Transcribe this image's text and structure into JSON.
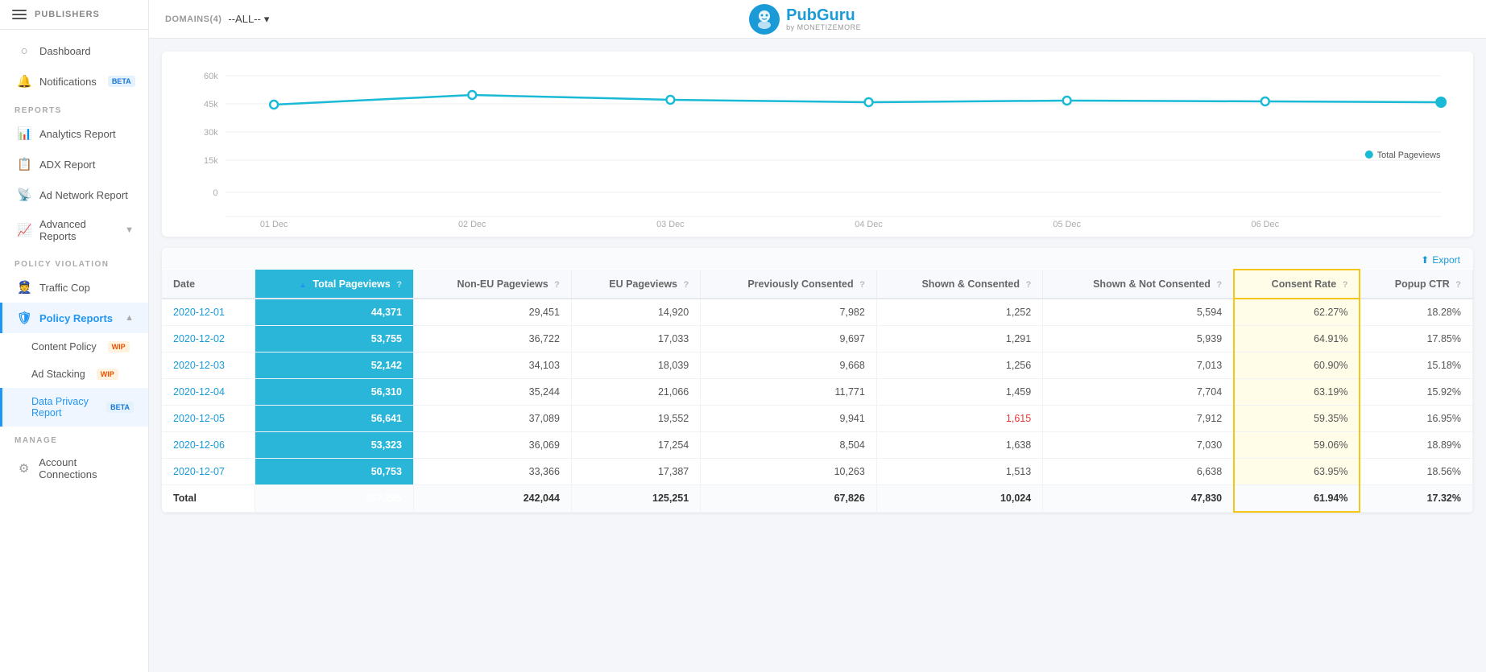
{
  "sidebar": {
    "publishers_label": "PUBLISHERS",
    "nav_items": [
      {
        "id": "dashboard",
        "label": "Dashboard",
        "icon": "○"
      },
      {
        "id": "notifications",
        "label": "Notifications",
        "badge": "BETA",
        "badge_type": "beta",
        "icon": "🔔"
      },
      {
        "id": "analytics_report",
        "label": "Analytics Report",
        "icon": "📊",
        "section": "REPORTS"
      },
      {
        "id": "adx_report",
        "label": "ADX Report",
        "icon": "📋"
      },
      {
        "id": "ad_network_report",
        "label": "Ad Network Report",
        "icon": "📡"
      },
      {
        "id": "advanced_reports",
        "label": "Advanced Reports",
        "icon": "📈",
        "has_chevron": true
      },
      {
        "id": "traffic_cop",
        "label": "Traffic Cop",
        "icon": "👮",
        "section": "POLICY VIOLATION"
      },
      {
        "id": "policy_reports",
        "label": "Policy Reports",
        "icon": "🛡",
        "has_chevron": true,
        "active": true
      },
      {
        "id": "content_policy",
        "label": "Content Policy",
        "badge": "WIP",
        "badge_type": "wip",
        "sub": true
      },
      {
        "id": "ad_stacking",
        "label": "Ad Stacking",
        "badge": "WIP",
        "badge_type": "wip",
        "sub": true
      },
      {
        "id": "data_privacy",
        "label": "Data Privacy Report",
        "badge": "BETA",
        "badge_type": "beta",
        "sub": true,
        "active_sub": true
      },
      {
        "id": "account_connections",
        "label": "Account Connections",
        "icon": "⚙",
        "section": "MANAGE"
      }
    ]
  },
  "topbar": {
    "domains_label": "DOMAINS(4)",
    "domains_value": "--ALL--",
    "logo_text": "PubGuru",
    "logo_sub": "by MONETIZEMORE"
  },
  "chart": {
    "y_labels": [
      "60k",
      "45k",
      "30k",
      "15k",
      "0"
    ],
    "x_labels": [
      "01 Dec",
      "02 Dec",
      "03 Dec",
      "04 Dec",
      "05 Dec",
      "06 Dec"
    ],
    "legend": "Total Pageviews",
    "data_points": [
      45000,
      50000,
      47500,
      46000,
      46500,
      46200,
      46000
    ]
  },
  "export_label": "Export",
  "table": {
    "columns": [
      {
        "id": "date",
        "label": "Date"
      },
      {
        "id": "total_pv",
        "label": "Total Pageviews",
        "sortable": true,
        "highlight": true
      },
      {
        "id": "non_eu_pv",
        "label": "Non-EU Pageviews"
      },
      {
        "id": "eu_pv",
        "label": "EU Pageviews"
      },
      {
        "id": "prev_consented",
        "label": "Previously Consented"
      },
      {
        "id": "shown_consented",
        "label": "Shown & Consented"
      },
      {
        "id": "shown_not_consented",
        "label": "Shown & Not Consented"
      },
      {
        "id": "consent_rate",
        "label": "Consent Rate",
        "highlighted": true
      },
      {
        "id": "popup_ctr",
        "label": "Popup CTR"
      }
    ],
    "rows": [
      {
        "date": "2020-12-01",
        "total_pv": "44,371",
        "non_eu_pv": "29,451",
        "eu_pv": "14,920",
        "prev_consented": "7,982",
        "shown_consented": "1,252",
        "shown_not_consented": "5,594",
        "consent_rate": "62.27%",
        "popup_ctr": "18.28%"
      },
      {
        "date": "2020-12-02",
        "total_pv": "53,755",
        "non_eu_pv": "36,722",
        "eu_pv": "17,033",
        "prev_consented": "9,697",
        "shown_consented": "1,291",
        "shown_not_consented": "5,939",
        "consent_rate": "64.91%",
        "popup_ctr": "17.85%"
      },
      {
        "date": "2020-12-03",
        "total_pv": "52,142",
        "non_eu_pv": "34,103",
        "eu_pv": "18,039",
        "prev_consented": "9,668",
        "shown_consented": "1,256",
        "shown_not_consented": "7,013",
        "consent_rate": "60.90%",
        "popup_ctr": "15.18%"
      },
      {
        "date": "2020-12-04",
        "total_pv": "56,310",
        "non_eu_pv": "35,244",
        "eu_pv": "21,066",
        "prev_consented": "11,771",
        "shown_consented": "1,459",
        "shown_not_consented": "7,704",
        "consent_rate": "63.19%",
        "popup_ctr": "15.92%"
      },
      {
        "date": "2020-12-05",
        "total_pv": "56,641",
        "non_eu_pv": "37,089",
        "eu_pv": "19,552",
        "prev_consented": "9,941",
        "shown_consented": "1,615",
        "shown_not_consented": "7,912",
        "consent_rate": "59.35%",
        "popup_ctr": "16.95%",
        "red_shown_consented": true
      },
      {
        "date": "2020-12-06",
        "total_pv": "53,323",
        "non_eu_pv": "36,069",
        "eu_pv": "17,254",
        "prev_consented": "8,504",
        "shown_consented": "1,638",
        "shown_not_consented": "7,030",
        "consent_rate": "59.06%",
        "popup_ctr": "18.89%"
      },
      {
        "date": "2020-12-07",
        "total_pv": "50,753",
        "non_eu_pv": "33,366",
        "eu_pv": "17,387",
        "prev_consented": "10,263",
        "shown_consented": "1,513",
        "shown_not_consented": "6,638",
        "consent_rate": "63.95%",
        "popup_ctr": "18.56%"
      }
    ],
    "total_row": {
      "label": "Total",
      "total_pv": "367,295",
      "non_eu_pv": "242,044",
      "eu_pv": "125,251",
      "prev_consented": "67,826",
      "shown_consented": "10,024",
      "shown_not_consented": "47,830",
      "consent_rate": "61.94%",
      "popup_ctr": "17.32%"
    }
  }
}
